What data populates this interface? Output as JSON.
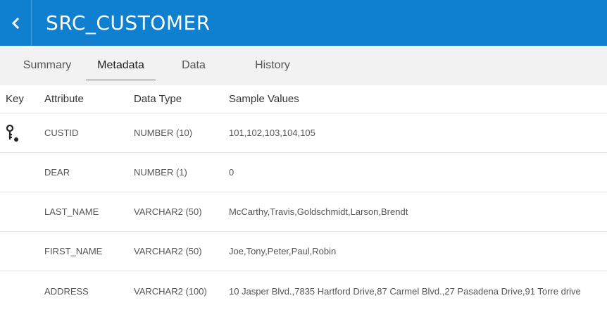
{
  "header": {
    "title": "SRC_CUSTOMER",
    "back_icon": "chevron-left-icon",
    "background": "#0f7fd0"
  },
  "tabs": [
    {
      "label": "Summary",
      "active": false
    },
    {
      "label": "Metadata",
      "active": true
    },
    {
      "label": "Data",
      "active": false
    },
    {
      "label": "History",
      "active": false
    }
  ],
  "table": {
    "columns": {
      "key": "Key",
      "attribute": "Attribute",
      "data_type": "Data Type",
      "sample_values": "Sample Values"
    },
    "rows": [
      {
        "is_key": true,
        "key_icon": "key-icon",
        "attribute": "CUSTID",
        "data_type": "NUMBER (10)",
        "sample_values": "101,102,103,104,105"
      },
      {
        "is_key": false,
        "attribute": "DEAR",
        "data_type": "NUMBER (1)",
        "sample_values": "0"
      },
      {
        "is_key": false,
        "attribute": "LAST_NAME",
        "data_type": "VARCHAR2 (50)",
        "sample_values": "McCarthy,Travis,Goldschmidt,Larson,Brendt"
      },
      {
        "is_key": false,
        "attribute": "FIRST_NAME",
        "data_type": "VARCHAR2 (50)",
        "sample_values": "Joe,Tony,Peter,Paul,Robin"
      },
      {
        "is_key": false,
        "attribute": "ADDRESS",
        "data_type": "VARCHAR2 (100)",
        "sample_values": "10 Jasper Blvd.,7835 Hartford Drive,87 Carmel Blvd.,27 Pasadena Drive,91 Torre drive"
      }
    ]
  }
}
